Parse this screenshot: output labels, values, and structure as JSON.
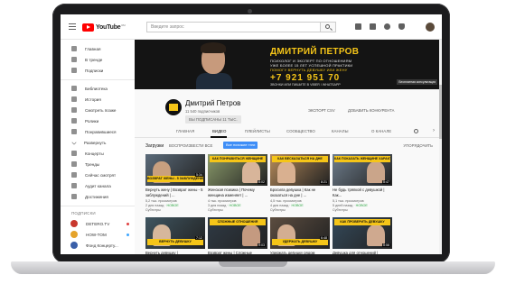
{
  "app": {
    "logo_text": "YouTube",
    "logo_sup": "RU"
  },
  "search": {
    "placeholder": "Введите запрос"
  },
  "sidebar": {
    "items": [
      {
        "label": "Главная",
        "icon": "home-icon"
      },
      {
        "label": "В тренде",
        "icon": "fire-icon"
      },
      {
        "label": "Подписки",
        "icon": "subscriptions-icon"
      },
      {
        "label": "Библиотека",
        "icon": "library-icon"
      },
      {
        "label": "История",
        "icon": "history-icon"
      },
      {
        "label": "Смотреть позже",
        "icon": "clock-icon"
      },
      {
        "label": "Ролики",
        "icon": "video-icon"
      },
      {
        "label": "Понравившиеся",
        "icon": "thumbs-up-icon"
      },
      {
        "label": "Развернуть",
        "icon": "chevron-down-icon"
      },
      {
        "label": "Концерты",
        "icon": "concert-icon"
      },
      {
        "label": "Тренды",
        "icon": "trending-icon"
      },
      {
        "label": "Сейчас смотрят",
        "icon": "live-icon"
      },
      {
        "label": "Аудит канала",
        "icon": "audit-icon"
      },
      {
        "label": "Достижения",
        "icon": "achievements-icon"
      }
    ],
    "subscriptions_heading": "ПОДПИСКИ",
    "subscriptions": [
      {
        "label": "DETERO.TV",
        "color": "#c8372d"
      },
      {
        "label": "HOW-TOM",
        "color": "#e5a32a"
      },
      {
        "label": "Фонд Концерту...",
        "color": "#3a5fa8"
      }
    ]
  },
  "banner": {
    "name": "ДМИТРИЙ ПЕТРОВ",
    "line1": "ПСИХОЛОГ И ЭКСПЕРТ ПО ОТНОШЕНИЯМ",
    "line2": "УЖЕ БОЛЕЕ 15 ЛЕТ УСПЕШНОЙ ПРАКТИКИ",
    "line3": "ПОМОГУ ВЕРНУТЬ ДЕВУШКУ ИЛИ ЖЕНУ",
    "phone": "+7  921  951  70",
    "line4": "ЗВОНКИ ИЛИ ПИШИТЕ В VIBER / WHATSAPP",
    "link": "Бесплатная консультация"
  },
  "channel": {
    "name": "Дмитрий Петров",
    "subscribers": "11 540 подписчиков",
    "subscribed_label": "ВЫ ПОДПИСАНЫ 11 ТЫС.",
    "export_label": "ЭКСПОРТ CSV",
    "add_competitor_label": "ДОБАВИТЬ КОНКУРЕНТА"
  },
  "tabs": [
    "ГЛАВНАЯ",
    "ВИДЕО",
    "ПЛЕЙЛИСТЫ",
    "СООБЩЕСТВО",
    "КАНАЛЫ",
    "О КАНАЛЕ"
  ],
  "active_tab": "ВИДЕО",
  "filters": {
    "uploads": "Загрузки",
    "play_all": "ВОСПРОИЗВЕСТИ ВСЕ",
    "similar": "Все похожие тэги",
    "sort": "УПОРЯДОЧИТЬ"
  },
  "videos": [
    {
      "thumb_text": "ВОЗВРАТ ЖЕНЫ - 5 ЗАБЛУЖДЕНИЙ",
      "duration": "5:34",
      "title": "Вернуть жену | Возврат жены - 5 заблуждений | ...",
      "views": "5,2 тыс. просмотров",
      "age": "2 дня назад",
      "new": "НОВОЕ",
      "extra": "Субтитры",
      "bg": "#5b6b7a",
      "person": "#c9a07f",
      "banner_pos": "bottom"
    },
    {
      "thumb_text": "КАК ПОНРАВИТЬСЯ ЖЕНЩИНЕ",
      "duration": "6:02",
      "title": "Женская психика | Почему женщина изменяет | ...",
      "views": "4 тыс. просмотров",
      "age": "3 дня назад",
      "new": "НОВОЕ",
      "extra": "Субтитры",
      "bg": "#8a9a6a",
      "person": "#d8b59a",
      "banner_pos": "top"
    },
    {
      "thumb_text": "КАК ВЕСКАЗАТЬСЯ НА ДНЕ",
      "duration": "8:21",
      "title": "Бросила девушка | Как не оказаться на дне | ...",
      "views": "4,5 тыс. просмотров",
      "age": "4 дня назад",
      "new": "НОВОЕ",
      "extra": "Субтитры",
      "bg": "#b58a5a",
      "person": "#d9b090",
      "banner_pos": "top"
    },
    {
      "thumb_text": "КАК ПОКАЗАТЬ ЖЕНЩИНЕ ХАРАКТЕР",
      "duration": "5:47",
      "title": "Не будь тряпкой с девушкой | Как...",
      "views": "5,1 тыс. просмотров",
      "age": "5 дней назад",
      "new": "НОВОЕ",
      "extra": "Субтитры",
      "bg": "#6e7d8c",
      "person": "#caa58a",
      "banner_pos": "top"
    },
    {
      "thumb_text": "ВЕРНУТЬ ДЕВУШКУ",
      "duration": "7:12",
      "title": "Вернуть девушку |",
      "views": "",
      "age": "",
      "new": "",
      "extra": "",
      "bg": "#3f5560",
      "person": "#d6b79c",
      "banner_pos": "bottom"
    },
    {
      "thumb_text": "СЛОЖНЫЕ ОТНОШЕНИЯ",
      "duration": "9:03",
      "title": "Возврат жены | Сложные",
      "views": "",
      "age": "",
      "new": "",
      "extra": "",
      "bg": "#2f3a45",
      "person": "#c49a80",
      "banner_pos": "top"
    },
    {
      "thumb_text": "УДЕРЖАТЬ ДЕВУШКУ",
      "duration": "6:48",
      "title": "Удержать девушку рядом",
      "views": "",
      "age": "",
      "new": "",
      "extra": "",
      "bg": "#5c4d40",
      "person": "#d3ae92",
      "banner_pos": "bottom"
    },
    {
      "thumb_text": "КАК ПРОВЕРИТЬ ДЕВУШКУ",
      "duration": "5:58",
      "title": "Девушка для отношений |",
      "views": "",
      "age": "",
      "new": "",
      "extra": "",
      "bg": "#34495a",
      "person": "#cfa98f",
      "banner_pos": "top"
    }
  ]
}
